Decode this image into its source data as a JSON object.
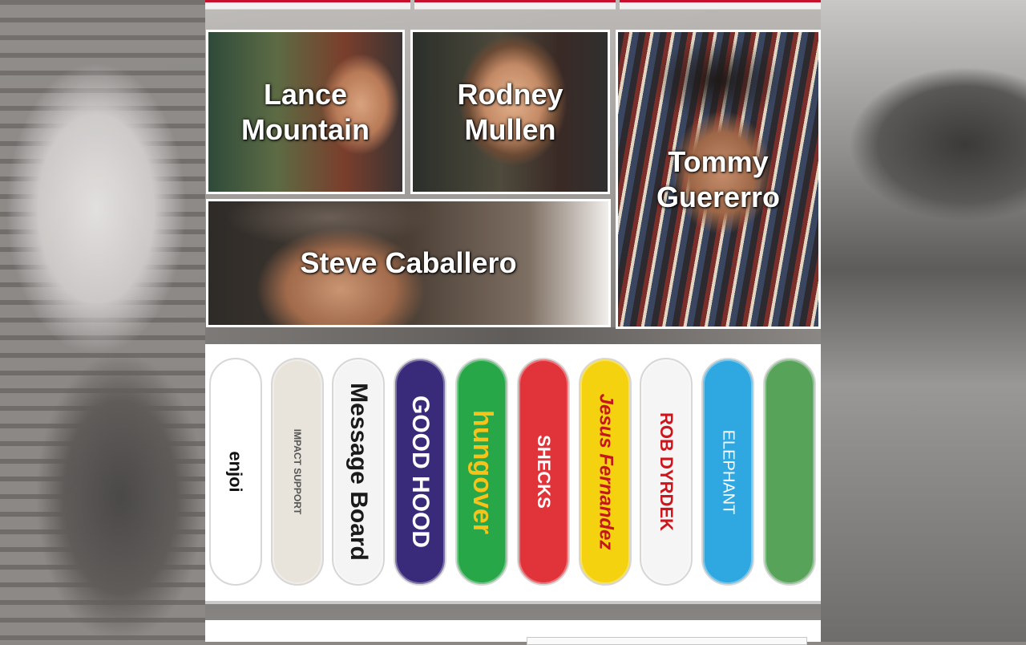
{
  "team": {
    "members": [
      {
        "name": "Lance Mountain"
      },
      {
        "name": "Rodney Mullen"
      },
      {
        "name": "Steve Caballero"
      },
      {
        "name": "Tommy Guererro"
      }
    ]
  },
  "decks": {
    "boards": [
      {
        "label": "enjoi",
        "color": "#ffffff",
        "text_color": "#111111"
      },
      {
        "label": "IMPACT SUPPORT",
        "color": "#e9e4db",
        "text_color": "#555555"
      },
      {
        "label": "Message Board",
        "color": "#f4f4f4",
        "text_color": "#1a1a1a"
      },
      {
        "label": "GOOD HOOD",
        "color": "#3a2a7a",
        "text_color": "#ffffff"
      },
      {
        "label": "hungover",
        "color": "#28a748",
        "text_color": "#f7c21a"
      },
      {
        "label": "SHECKS",
        "color": "#e0343a",
        "text_color": "#ffffff"
      },
      {
        "label": "Jesus Fernandez",
        "color": "#f4d20f",
        "text_color": "#c4161c"
      },
      {
        "label": "ROB DYRDEK",
        "color": "#f5f5f5",
        "text_color": "#d0141c"
      },
      {
        "label": "ELEPHANT",
        "color": "#2fa7e0",
        "text_color": "#ffffff"
      },
      {
        "label": "",
        "color": "#58a35a",
        "text_color": "#1f3b20"
      }
    ]
  }
}
